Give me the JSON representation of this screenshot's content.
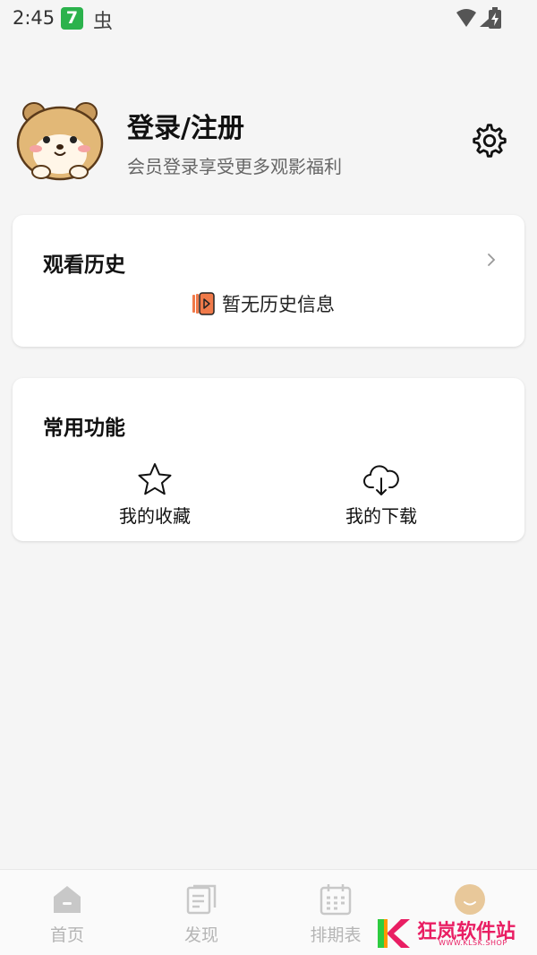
{
  "status_bar": {
    "time": "2:45",
    "app_badge": "7",
    "bug_glyph": "虫",
    "icons": [
      "wifi-icon",
      "signal-icon",
      "battery-charging-icon"
    ]
  },
  "profile": {
    "title": "登录/注册",
    "subtitle": "会员登录享受更多观影福利",
    "avatar": "hamster-avatar",
    "settings_icon": "gear-icon"
  },
  "history": {
    "title": "观看历史",
    "empty_text": "暂无历史信息",
    "empty_icon": "play-book-icon"
  },
  "features": {
    "title": "常用功能",
    "items": [
      {
        "label": "我的收藏",
        "icon": "star-icon"
      },
      {
        "label": "我的下载",
        "icon": "cloud-download-icon"
      }
    ]
  },
  "bottom_nav": {
    "items": [
      {
        "label": "首页",
        "icon": "home-icon"
      },
      {
        "label": "发现",
        "icon": "discover-icon"
      },
      {
        "label": "排期表",
        "icon": "calendar-icon"
      },
      {
        "label": "",
        "icon": "mine-face-icon"
      }
    ]
  },
  "watermark": {
    "text": "狂岚软件站",
    "subtext": "WWW.KLSK.SHOP"
  },
  "colors": {
    "background": "#f5f5f5",
    "card": "#ffffff",
    "accent_orange": "#f07a4a",
    "nav_inactive": "#b5b5b5",
    "watermark": "#e91e63"
  }
}
